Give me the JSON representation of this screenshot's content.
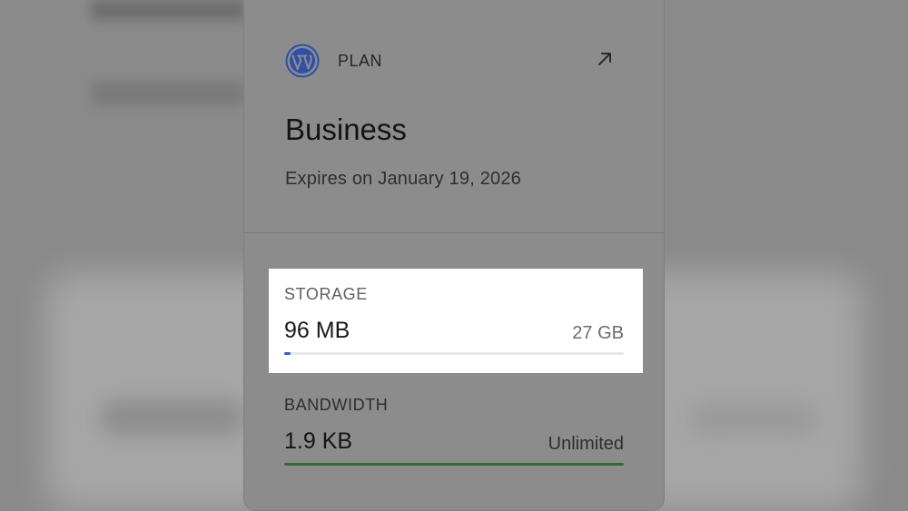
{
  "plan": {
    "label": "PLAN",
    "name": "Business",
    "expiry": "Expires on January 19, 2026",
    "logo_icon": "wordpress-logo",
    "external_icon": "arrow-up-right-icon"
  },
  "storage": {
    "label": "STORAGE",
    "used": "96 MB",
    "limit": "27 GB",
    "usage_fraction": 0.0035,
    "bar_color": "#3858c7"
  },
  "bandwidth": {
    "label": "BANDWIDTH",
    "used": "1.9 KB",
    "limit": "Unlimited",
    "usage_fraction": 1.0,
    "bar_color": "#2f6b36"
  }
}
